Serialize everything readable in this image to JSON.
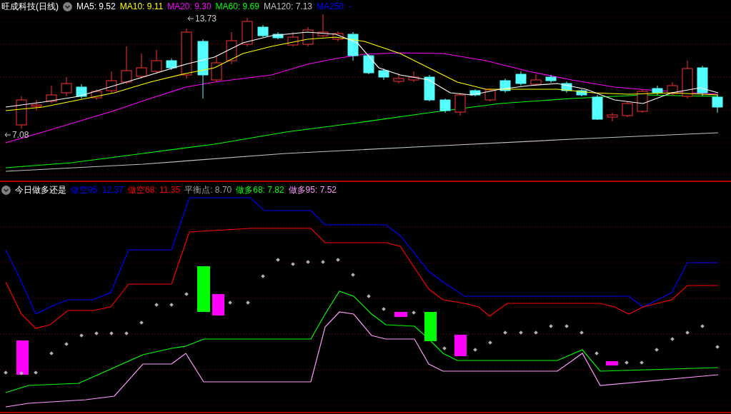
{
  "main_panel": {
    "title": "旺成科技(日线)",
    "indicators": [
      {
        "label": "MA5: 9.52",
        "color": "#ffffff"
      },
      {
        "label": "MA10: 9.11",
        "color": "#ffff00"
      },
      {
        "label": "MA20: 9.30",
        "color": "#ff00ff"
      },
      {
        "label": "MA60: 9.69",
        "color": "#00ff00"
      },
      {
        "label": "MA120: 7.13",
        "color": "#c0c0c0"
      },
      {
        "label": "MA250: -",
        "color": "#0000ff"
      }
    ],
    "high_label": "13.73",
    "low_label": "7.08"
  },
  "sub_panel": {
    "title": "今日做多还是",
    "indicators": [
      {
        "label": "做空95: 12.37",
        "color": "#0000ff"
      },
      {
        "label": "做空68: 11.35",
        "color": "#ff0000"
      },
      {
        "label": "平衡点: 8.70",
        "color": "#a0a0a0"
      },
      {
        "label": "做多68: 7.82",
        "color": "#00ff00"
      },
      {
        "label": "做多95: 7.52",
        "color": "#ff99ff"
      }
    ]
  }
}
